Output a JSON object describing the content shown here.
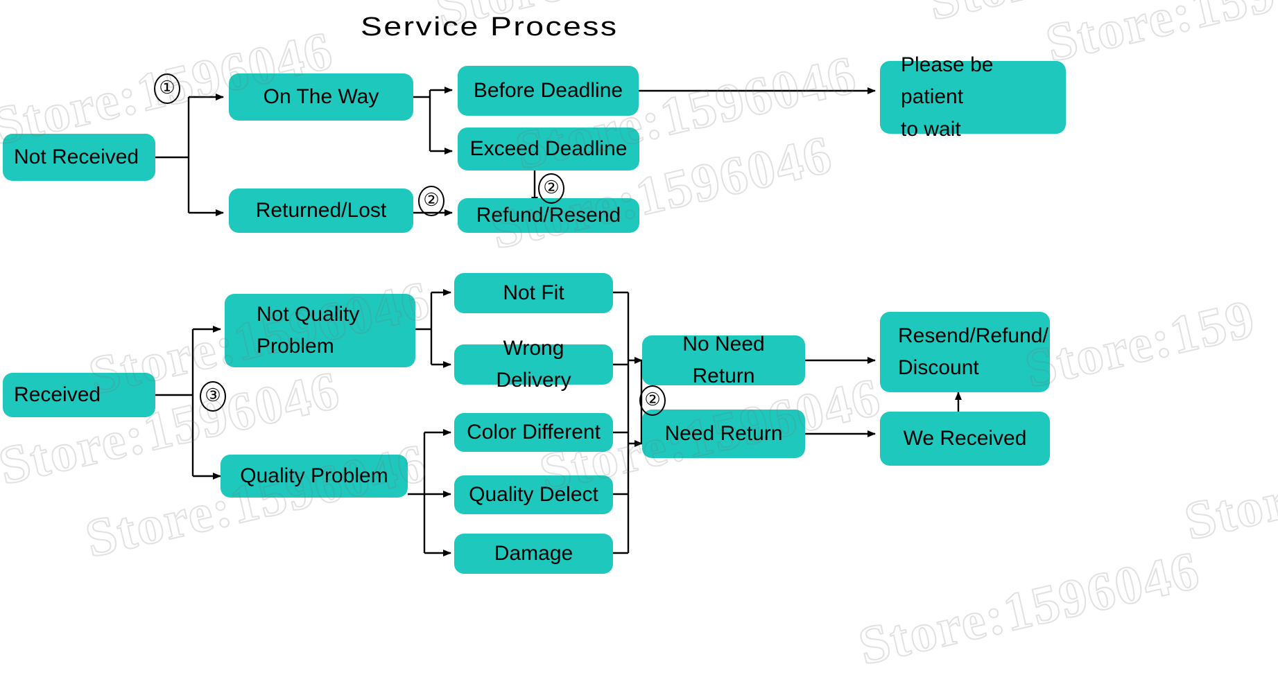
{
  "title": "Service Process",
  "colors": {
    "node_fill": "#1ec8bd",
    "node_text": "#000000",
    "connector": "#000000",
    "background": "#ffffff",
    "watermark": "#cccccc"
  },
  "watermark": {
    "text": "Store:1596046",
    "short_text": "Store:159",
    "shortest_text": "Stor"
  },
  "markers": {
    "one": "①",
    "two": "②",
    "three": "③"
  },
  "nodes": {
    "not_received": "Not Received",
    "on_the_way": "On The Way",
    "returned_lost": "Returned/Lost",
    "before_deadline": "Before Deadline",
    "exceed_deadline": "Exceed Deadline",
    "refund_resend": "Refund/Resend",
    "please_be_patient": "Please be patient\nto wait",
    "received": "Received",
    "not_quality_problem": "Not Quality\nProblem",
    "quality_problem": "Quality Problem",
    "not_fit": "Not Fit",
    "wrong_delivery": "Wrong Delivery",
    "color_different": "Color Different",
    "quality_delect": "Quality Delect",
    "damage": "Damage",
    "no_need_return": "No Need Return",
    "need_return": "Need Return",
    "resend_refund_discount": "Resend/Refund/\nDiscount",
    "we_received": "We Received"
  },
  "flow": {
    "type": "flowchart",
    "edges": [
      {
        "from": "not_received",
        "to": "on_the_way",
        "label": "①"
      },
      {
        "from": "not_received",
        "to": "returned_lost",
        "label": ""
      },
      {
        "from": "on_the_way",
        "to": "before_deadline",
        "label": ""
      },
      {
        "from": "on_the_way",
        "to": "exceed_deadline",
        "label": ""
      },
      {
        "from": "before_deadline",
        "to": "please_be_patient",
        "label": ""
      },
      {
        "from": "exceed_deadline",
        "to": "refund_resend",
        "label": "②"
      },
      {
        "from": "returned_lost",
        "to": "refund_resend",
        "label": "②"
      },
      {
        "from": "received",
        "to": "not_quality_problem",
        "label": "③"
      },
      {
        "from": "received",
        "to": "quality_problem",
        "label": ""
      },
      {
        "from": "not_quality_problem",
        "to": "not_fit",
        "label": ""
      },
      {
        "from": "not_quality_problem",
        "to": "wrong_delivery",
        "label": ""
      },
      {
        "from": "quality_problem",
        "to": "color_different",
        "label": ""
      },
      {
        "from": "quality_problem",
        "to": "quality_delect",
        "label": ""
      },
      {
        "from": "quality_problem",
        "to": "damage",
        "label": ""
      },
      {
        "from": "not_fit",
        "to": "no_need_return",
        "label": "②"
      },
      {
        "from": "wrong_delivery",
        "to": "need_return",
        "label": "②"
      },
      {
        "from": "color_different",
        "to": "no_need_return",
        "label": "②"
      },
      {
        "from": "quality_delect",
        "to": "need_return",
        "label": "②"
      },
      {
        "from": "damage",
        "to": "need_return",
        "label": "②"
      },
      {
        "from": "no_need_return",
        "to": "resend_refund_discount",
        "label": ""
      },
      {
        "from": "need_return",
        "to": "we_received",
        "label": ""
      },
      {
        "from": "we_received",
        "to": "resend_refund_discount",
        "label": ""
      }
    ]
  }
}
